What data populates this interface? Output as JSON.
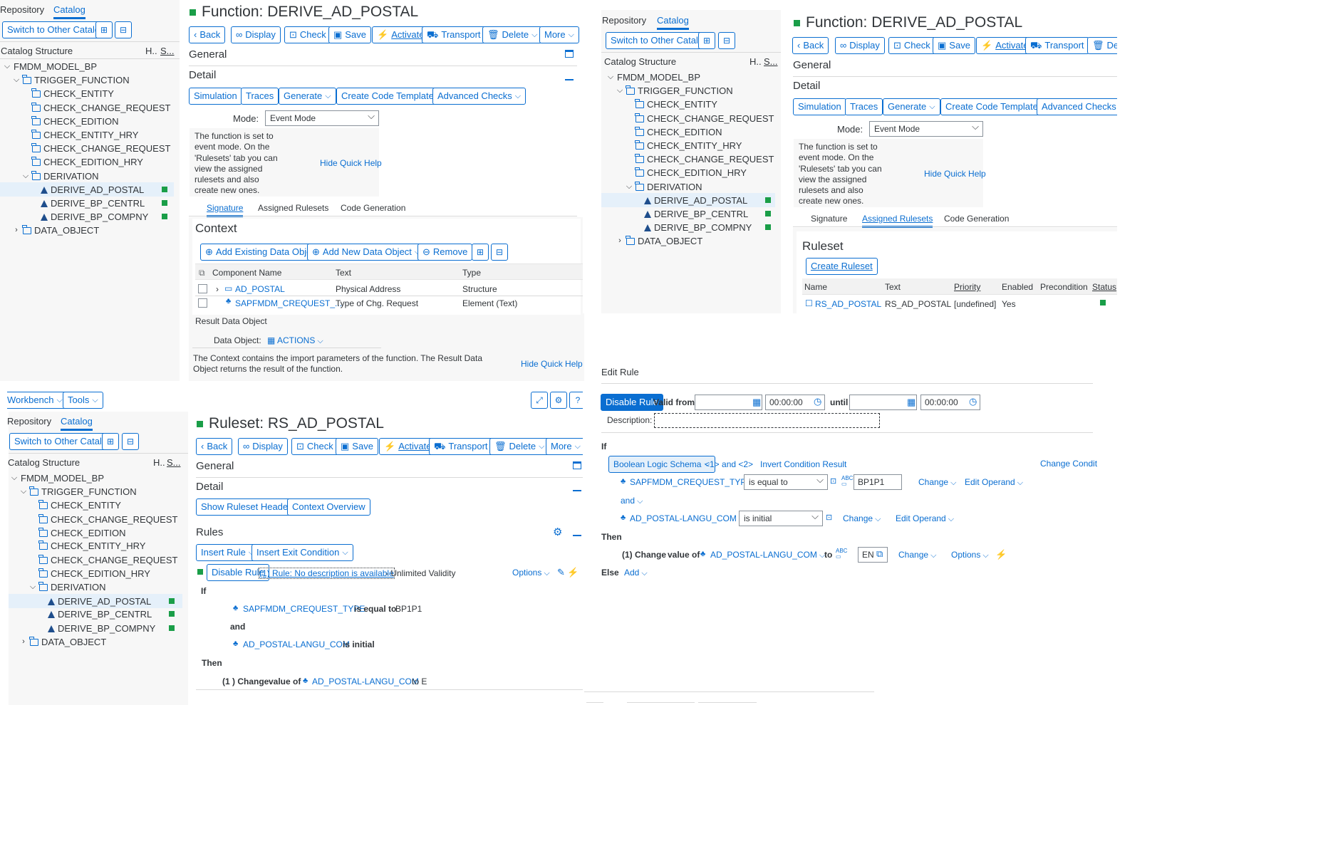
{
  "catalog_tabs": [
    "Repository",
    "Catalog"
  ],
  "switch_catalog": "Switch to Other Catalog",
  "catalog_header": {
    "title": "Catalog Structure",
    "col_h": "H..",
    "col_s": "S..."
  },
  "tree": {
    "root": "FMDM_MODEL_BP",
    "trigger": "TRIGGER_FUNCTION",
    "trigger_children": [
      "CHECK_ENTITY",
      "CHECK_CHANGE_REQUEST",
      "CHECK_EDITION",
      "CHECK_ENTITY_HRY",
      "CHECK_CHANGE_REQUEST",
      "CHECK_EDITION_HRY"
    ],
    "derivation": "DERIVATION",
    "derivation_children": [
      "DERIVE_AD_POSTAL",
      "DERIVE_BP_CENTRL",
      "DERIVE_BP_COMPNY"
    ],
    "data_object": "DATA_OBJECT"
  },
  "function_title": "Function: DERIVE_AD_POSTAL",
  "toolbar": {
    "back": "Back",
    "display": "Display",
    "check": "Check",
    "save": "Save",
    "activate": "Activate",
    "transport": "Transport",
    "delete": "Delete",
    "more": "More"
  },
  "general": "General",
  "detail": "Detail",
  "detail_buttons": {
    "simulation": "Simulation",
    "traces": "Traces",
    "generate": "Generate",
    "code_template": "Create Code Template",
    "advanced": "Advanced Checks"
  },
  "mode": {
    "label": "Mode:",
    "value": "Event Mode"
  },
  "quick_help": {
    "lines": [
      "The function is set to",
      "event mode. On the",
      "'Rulesets' tab you can",
      "view the assigned",
      "rulesets and also",
      "create new ones."
    ],
    "hide": "Hide Quick Help"
  },
  "func_tabs": [
    "Signature",
    "Assigned Rulesets",
    "Code Generation"
  ],
  "context": {
    "title": "Context",
    "add_existing": "Add Existing Data Object",
    "add_new": "Add New Data Object",
    "remove": "Remove",
    "cols": [
      "Component Name",
      "Text",
      "Type"
    ],
    "rows": [
      {
        "name": "AD_POSTAL",
        "text": "Physical Address",
        "type": "Structure"
      },
      {
        "name": "SAPFMDM_CREQUEST_...",
        "text": "Type of Chg. Request",
        "type": "Element (Text)"
      }
    ],
    "result_label": "Result Data Object",
    "data_object_label": "Data Object:",
    "data_object_value": "ACTIONS",
    "help_lines": [
      "The Context contains the import parameters of the function. The Result Data",
      "Object returns the result of the function."
    ]
  },
  "ruleset_panel": {
    "title": "Ruleset",
    "create": "Create Ruleset",
    "cols": [
      "Name",
      "Text",
      "Priority",
      "Enabled",
      "Precondition",
      "Status"
    ],
    "row": {
      "name": "RS_AD_POSTAL",
      "text": "RS_AD_POSTAL",
      "priority": "[undefined]",
      "enabled": "Yes"
    }
  },
  "workbench": {
    "workbench": "Workbench",
    "tools": "Tools"
  },
  "ruleset_title": "Ruleset: RS_AD_POSTAL",
  "ruleset_detail": {
    "show_header": "Show Ruleset Header",
    "context_overview": "Context Overview"
  },
  "rules": {
    "title": "Rules",
    "insert_rule": "Insert Rule",
    "insert_exit": "Insert Exit Condition",
    "disable_rule": "Disable Rule",
    "rule_link": "(1) Rule: No description is available",
    "validity": "- Unlimited Validity",
    "options": "Options",
    "if": "If",
    "cond1_obj": "SAPFMDM_CREQUEST_TYPE",
    "cond1_op": "is equal to",
    "cond1_val": "BP1P1",
    "and": "and",
    "cond2_obj": "AD_POSTAL-LANGU_COM",
    "cond2_op": "is initial",
    "then": "Then",
    "action_prefix": "(1 ) Change",
    "action_value_of": "value of",
    "action_obj": "AD_POSTAL-LANGU_COM",
    "action_to": "to E"
  },
  "edit_rule": {
    "title": "Edit Rule",
    "disable": "Disable Rule",
    "valid_from": "Valid from",
    "time1": "00:00:00",
    "until": "until",
    "time2": "00:00:00",
    "description": "Description:",
    "if": "If",
    "schema": "Boolean Logic Schema",
    "schema_link": "<1> and <2>",
    "invert": "Invert Condition Result",
    "change_cond": "Change Condit",
    "c1_obj": "SAPFMDM_CREQUEST_TYPE",
    "c1_op": "is equal to",
    "c1_val": "BP1P1",
    "change": "Change",
    "edit_operand": "Edit Operand",
    "and": "and",
    "c2_obj": "AD_POSTAL-LANGU_COM",
    "c2_op": "is initial",
    "then": "Then",
    "action_prefix": "(1) Change",
    "action_value_of": "value of",
    "action_obj": "AD_POSTAL-LANGU_COM",
    "to": "to",
    "to_val": "EN",
    "options": "Options",
    "else": "Else",
    "add": "Add"
  },
  "colors": {
    "accent": "#0a6ed1",
    "active": "#1a9e48",
    "text": "#32363a",
    "panel_bg": "#f7f7f7"
  }
}
